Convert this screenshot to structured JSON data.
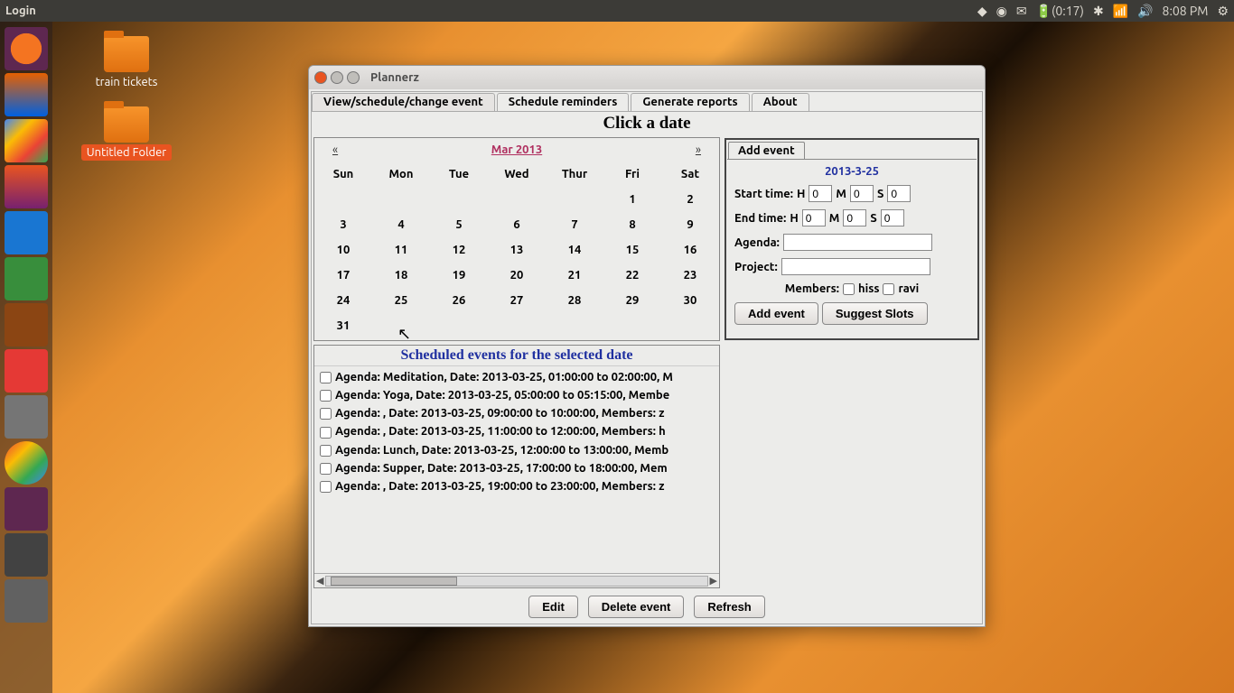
{
  "top_panel": {
    "menu": "Login",
    "battery": "(0:17)",
    "time": "8:08 PM"
  },
  "desktop": {
    "icons": [
      {
        "label": "train tickets"
      },
      {
        "label": "Untitled Folder",
        "selected": true
      }
    ]
  },
  "window": {
    "title": "Plannerz",
    "tabs": [
      "View/schedule/change event",
      "Schedule reminders",
      "Generate reports",
      "About"
    ],
    "click_date_title": "Click a date",
    "calendar": {
      "prev": "«",
      "next": "»",
      "month": "Mar 2013",
      "days": [
        "Sun",
        "Mon",
        "Tue",
        "Wed",
        "Thur",
        "Fri",
        "Sat"
      ],
      "weeks": [
        [
          "",
          "",
          "",
          "",
          "",
          "1",
          "2"
        ],
        [
          "3",
          "4",
          "5",
          "6",
          "7",
          "8",
          "9"
        ],
        [
          "10",
          "11",
          "12",
          "13",
          "14",
          "15",
          "16"
        ],
        [
          "17",
          "18",
          "19",
          "20",
          "21",
          "22",
          "23"
        ],
        [
          "24",
          "25",
          "26",
          "27",
          "28",
          "29",
          "30"
        ],
        [
          "31",
          "",
          "",
          "",
          "",
          "",
          ""
        ]
      ]
    },
    "add_event": {
      "tab": "Add event",
      "date": "2013-3-25",
      "start_label": "Start time:",
      "end_label": "End time:",
      "h": "H",
      "m": "M",
      "s": "S",
      "val": "0",
      "agenda_label": "Agenda:",
      "project_label": "Project:",
      "members_label": "Members:",
      "member1": "hiss",
      "member2": "ravi",
      "add_btn": "Add event",
      "suggest_btn": "Suggest Slots"
    },
    "events": {
      "title": "Scheduled events for the selected date",
      "list": [
        "Agenda: Meditation, Date: 2013-03-25, 01:00:00 to 02:00:00, M",
        "Agenda: Yoga, Date: 2013-03-25, 05:00:00 to 05:15:00, Membe",
        "Agenda: , Date: 2013-03-25, 09:00:00 to 10:00:00, Members: z",
        "Agenda: , Date: 2013-03-25, 11:00:00 to 12:00:00, Members: h",
        "Agenda: Lunch, Date: 2013-03-25, 12:00:00 to 13:00:00, Memb",
        "Agenda: Supper, Date: 2013-03-25, 17:00:00 to 18:00:00, Mem",
        "Agenda: , Date: 2013-03-25, 19:00:00 to 23:00:00, Members: z"
      ]
    },
    "bottom_buttons": {
      "edit": "Edit",
      "delete": "Delete event",
      "refresh": "Refresh"
    }
  }
}
